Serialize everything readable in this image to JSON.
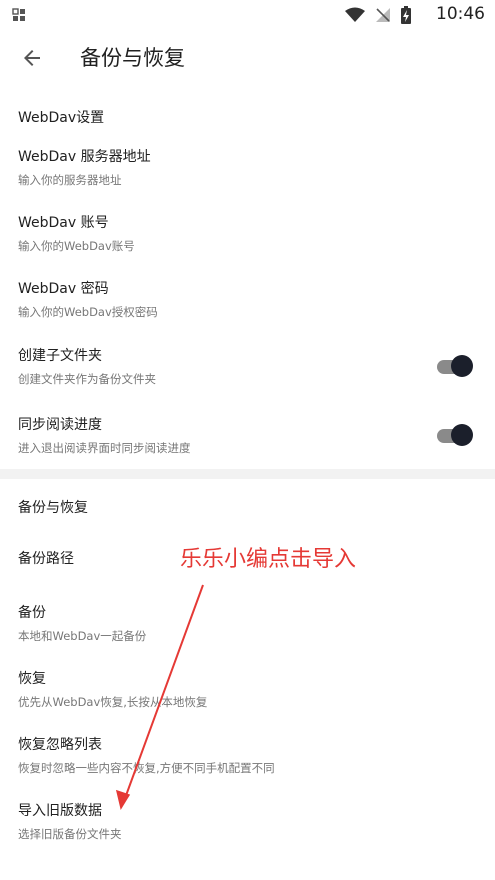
{
  "status_bar": {
    "time": "10:46"
  },
  "toolbar": {
    "title": "备份与恢复"
  },
  "webdav_section": {
    "header": "WebDav设置",
    "items": [
      {
        "title": "WebDav 服务器地址",
        "summary": "输入你的服务器地址"
      },
      {
        "title": "WebDav 账号",
        "summary": "输入你的WebDav账号"
      },
      {
        "title": "WebDav 密码",
        "summary": "输入你的WebDav授权密码"
      },
      {
        "title": "创建子文件夹",
        "summary": "创建文件夹作为备份文件夹",
        "switch_on": true
      },
      {
        "title": "同步阅读进度",
        "summary": "进入退出阅读界面时同步阅读进度",
        "switch_on": true
      }
    ]
  },
  "backup_section": {
    "header": "备份与恢复",
    "items": [
      {
        "title": "备份路径"
      },
      {
        "title": "备份",
        "summary": "本地和WebDav一起备份"
      },
      {
        "title": "恢复",
        "summary": "优先从WebDav恢复,长按从本地恢复"
      },
      {
        "title": "恢复忽略列表",
        "summary": "恢复时忽略一些内容不恢复,方便不同手机配置不同"
      },
      {
        "title": "导入旧版数据",
        "summary": "选择旧版备份文件夹"
      }
    ]
  },
  "annotation": {
    "text": "乐乐小编点击导入",
    "color": "#e53935"
  }
}
